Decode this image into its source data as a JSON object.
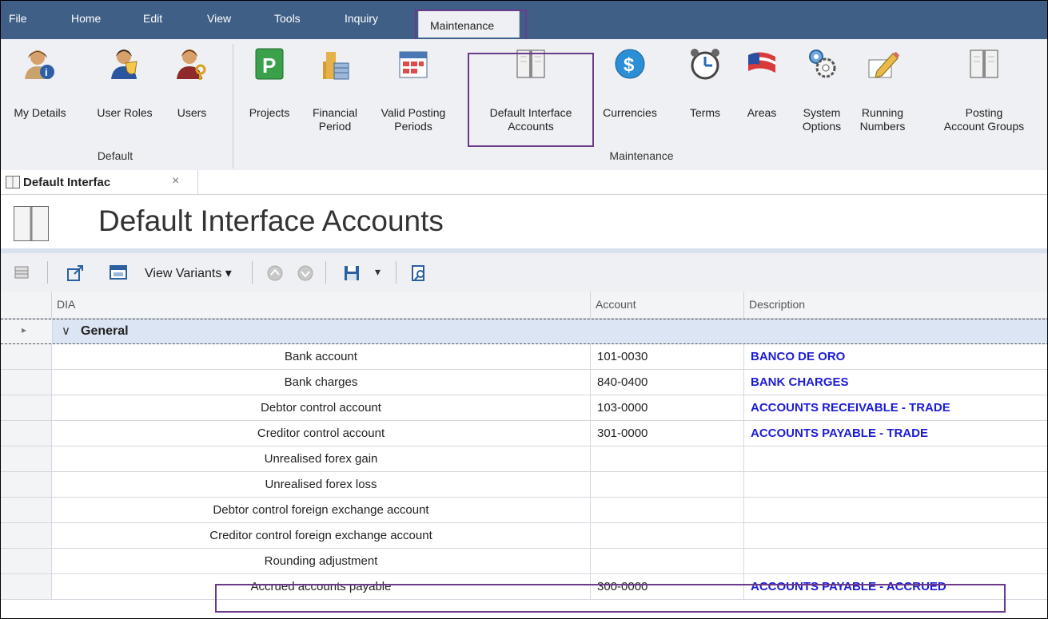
{
  "menu": {
    "items": [
      "File",
      "Home",
      "Edit",
      "View",
      "Tools",
      "Inquiry"
    ],
    "active": "Maintenance"
  },
  "ribbon": {
    "default_group": {
      "label": "Default",
      "buttons": [
        {
          "line1": "My Details",
          "line2": "",
          "icon": "user-info-icon"
        },
        {
          "line1": "User Roles",
          "line2": "",
          "icon": "user-roles-icon"
        },
        {
          "line1": "Users",
          "line2": "",
          "icon": "users-key-icon"
        }
      ]
    },
    "maintenance_group": {
      "label": "Maintenance",
      "buttons": [
        {
          "line1": "Projects",
          "line2": "",
          "icon": "projects-icon"
        },
        {
          "line1": "Financial",
          "line2": "Period",
          "icon": "financial-period-icon"
        },
        {
          "line1": "Valid Posting",
          "line2": "Periods",
          "icon": "calendar-icon"
        },
        {
          "line1": "Default Interface",
          "line2": "Accounts",
          "icon": "book-icon"
        },
        {
          "line1": "Currencies",
          "line2": "",
          "icon": "dollar-icon"
        },
        {
          "line1": "Terms",
          "line2": "",
          "icon": "clock-icon"
        },
        {
          "line1": "Areas",
          "line2": "",
          "icon": "flag-icon"
        },
        {
          "line1": "System",
          "line2": "Options",
          "icon": "gears-icon"
        },
        {
          "line1": "Running",
          "line2": "Numbers",
          "icon": "pencil-icon"
        },
        {
          "line1": "Posting",
          "line2": "Account Groups",
          "icon": "book-icon"
        }
      ]
    }
  },
  "doc_tab": {
    "label": "Default Interfac",
    "close": "×"
  },
  "page": {
    "title": "Default Interface Accounts"
  },
  "toolbar": {
    "view_variants": "View Variants",
    "view_variants_arrow": "▾",
    "save_arrow": "▾"
  },
  "grid": {
    "columns": {
      "dia": "DIA",
      "account": "Account",
      "description": "Description"
    },
    "group": {
      "toggle": "∨",
      "label": "General",
      "expander": "▸"
    },
    "rows": [
      {
        "dia": "Bank account",
        "account": "101-0030",
        "description": "BANCO DE ORO"
      },
      {
        "dia": "Bank charges",
        "account": "840-0400",
        "description": "BANK CHARGES"
      },
      {
        "dia": "Debtor control account",
        "account": "103-0000",
        "description": "ACCOUNTS RECEIVABLE - TRADE"
      },
      {
        "dia": "Creditor control account",
        "account": "301-0000",
        "description": "ACCOUNTS PAYABLE - TRADE"
      },
      {
        "dia": "Unrealised forex gain",
        "account": "",
        "description": ""
      },
      {
        "dia": "Unrealised forex loss",
        "account": "",
        "description": ""
      },
      {
        "dia": "Debtor control foreign exchange account",
        "account": "",
        "description": ""
      },
      {
        "dia": "Creditor control foreign exchange account",
        "account": "",
        "description": ""
      },
      {
        "dia": "Rounding adjustment",
        "account": "",
        "description": ""
      },
      {
        "dia": "Accrued accounts payable",
        "account": "300-0000",
        "description": "ACCOUNTS PAYABLE - ACCRUED"
      }
    ]
  },
  "colors": {
    "menubar": "#3f5f87",
    "highlight": "#6b3a8a",
    "description_text": "#1c1cd6",
    "group_row": "#dbe5f3"
  }
}
